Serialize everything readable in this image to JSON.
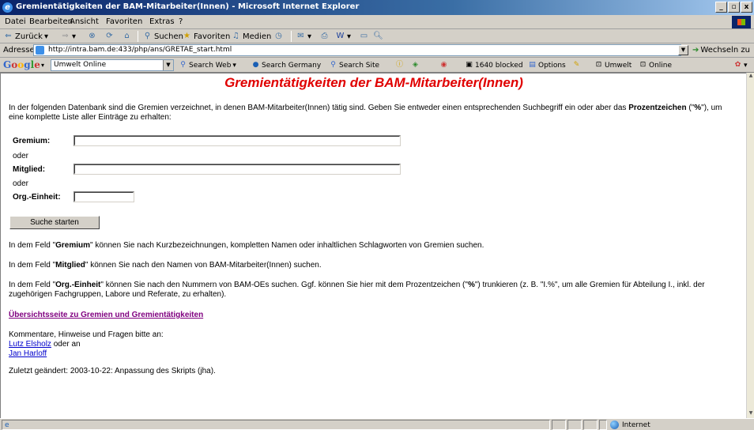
{
  "window": {
    "title": "Gremientätigkeiten der BAM-Mitarbeiter(Innen) - Microsoft Internet Explorer",
    "min": "_",
    "max": "▫",
    "close": "x"
  },
  "menu": {
    "items": [
      "Datei",
      "Bearbeiten",
      "Ansicht",
      "Favoriten",
      "Extras",
      "?"
    ]
  },
  "toolbar": {
    "back": "Zurück",
    "search": "Suchen",
    "favorites": "Favoriten",
    "media": "Medien"
  },
  "address": {
    "label": "Adresse",
    "url": "http://intra.bam.de:433/php/ans/GRETAE_start.html",
    "go": "Wechseln zu"
  },
  "google": {
    "logo": [
      "G",
      "o",
      "o",
      "g",
      "l",
      "e"
    ],
    "search_value": "Umwelt Online",
    "search_web": "Search Web",
    "search_germany": "Search Germany",
    "search_site": "Search Site",
    "blocked": "1640 blocked",
    "options": "Options",
    "umwelt": "Umwelt",
    "online": "Online"
  },
  "page": {
    "title": "Gremientätigkeiten der BAM-Mitarbeiter(Innen)",
    "intro_a": "In der folgenden Datenbank sind die Gremien verzeichnet, in denen BAM-Mitarbeiter(Innen) tätig sind. Geben Sie entweder einen entsprechenden Suchbegriff ein oder aber das ",
    "intro_bold": "Prozentzeichen",
    "intro_b": " (\"",
    "intro_pct": "%",
    "intro_c": "\"), um eine komplette Liste aller Einträge zu erhalten:",
    "form": {
      "gremium_label": "Gremium:",
      "or1": "oder",
      "mitglied_label": "Mitglied:",
      "or2": "oder",
      "org_label": "Org.-Einheit:",
      "gremium_value": "",
      "mitglied_value": "",
      "org_value": "",
      "submit": "Suche starten"
    },
    "help1_a": "In dem Feld \"",
    "help1_bold": "Gremium",
    "help1_b": "\" können Sie nach Kurzbezeichnungen, kompletten Namen oder inhaltlichen Schlagworten von Gremien suchen.",
    "help2_a": "In dem Feld \"",
    "help2_bold": "Mitglied",
    "help2_b": "\" können Sie nach den Namen von BAM-Mitarbeiter(Innen) suchen.",
    "help3_a": "In dem Feld \"",
    "help3_bold": "Org.-Einheit",
    "help3_b": "\" können Sie nach den Nummern von BAM-OEs suchen. Ggf. können Sie hier mit dem Prozentzeichen (\"",
    "help3_pct": "%",
    "help3_c": "\") trunkieren (z. B. \"I.%\", um alle Gremien für Abteilung I., inkl. der zugehörigen Fachgruppen, Labore und Referate, zu erhalten).",
    "overview_link": "Übersichtsseite zu Gremien und Gremientätigkeiten",
    "comments": "Kommentare, Hinweise und Fragen bitte an:",
    "contact1": "Lutz Elsholz",
    "contact_or": " oder an",
    "contact2": "Jan Harloff",
    "updated": "Zuletzt geändert: 2003-10-22: Anpassung des Skripts (jha)."
  },
  "status": {
    "zone": "Internet"
  }
}
